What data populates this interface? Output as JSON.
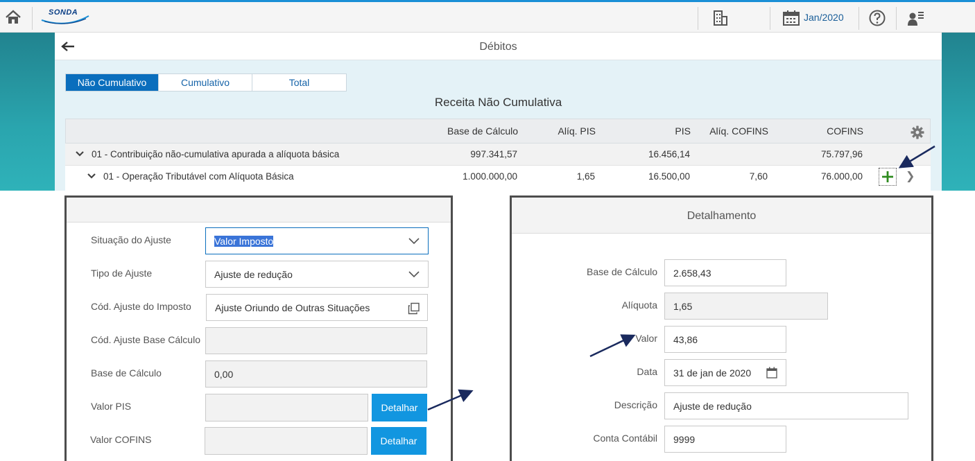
{
  "shell": {
    "logo_text": "SONDA",
    "period": "Jan/2020",
    "icons": [
      "home-icon",
      "building-icon",
      "calendar-icon",
      "help-icon",
      "user-menu-icon"
    ]
  },
  "page": {
    "title": "Débitos",
    "tabs": [
      {
        "label": "Não Cumulativo",
        "active": true
      },
      {
        "label": "Cumulativo",
        "active": false
      },
      {
        "label": "Total",
        "active": false
      }
    ],
    "section_title": "Receita Não Cumulativa"
  },
  "grid": {
    "columns": [
      "Base de Cálculo",
      "Alíq. PIS",
      "PIS",
      "Alíq. COFINS",
      "COFINS"
    ],
    "rows": [
      {
        "label": "01 - Contribuição não-cumulativa apurada a alíquota básica",
        "base": "997.341,57",
        "aliq_pis": "",
        "pis": "16.456,14",
        "aliq_cofins": "",
        "cofins": "75.797,96"
      },
      {
        "label": "01 - Operação Tributável com Alíquota Básica",
        "base": "1.000.000,00",
        "aliq_pis": "1,65",
        "pis": "16.500,00",
        "aliq_cofins": "7,60",
        "cofins": "76.000,00"
      }
    ]
  },
  "ajuste_form": {
    "situacao_label": "Situação do Ajuste",
    "situacao_value": "Valor Imposto",
    "tipo_label": "Tipo de Ajuste",
    "tipo_value": "Ajuste de redução",
    "cod_imposto_label": "Cód. Ajuste do Imposto",
    "cod_imposto_value": "Ajuste Oriundo de Outras Situações",
    "cod_base_label": "Cód. Ajuste Base Cálculo",
    "cod_base_value": "",
    "base_label": "Base de Cálculo",
    "base_value": "0,00",
    "pis_label": "Valor PIS",
    "pis_value": "",
    "cofins_label": "Valor COFINS",
    "cofins_value": "",
    "detalhar_label": "Detalhar"
  },
  "detalhamento": {
    "title": "Detalhamento",
    "base_label": "Base de Cálculo",
    "base_value": "2.658,43",
    "aliquota_label": "Alíquota",
    "aliquota_value": "1,65",
    "valor_label": "Valor",
    "valor_value": "43,86",
    "data_label": "Data",
    "data_value": "31 de jan de 2020",
    "descricao_label": "Descrição",
    "descricao_value": "Ajuste de redução",
    "conta_label": "Conta Contábil",
    "conta_value": "9999"
  },
  "colors": {
    "accent": "#0a6ebd",
    "button": "#1296e0",
    "teal": "#2aa5ae",
    "add_green": "#2e8b1e",
    "annotation": "#1a2a5e"
  }
}
